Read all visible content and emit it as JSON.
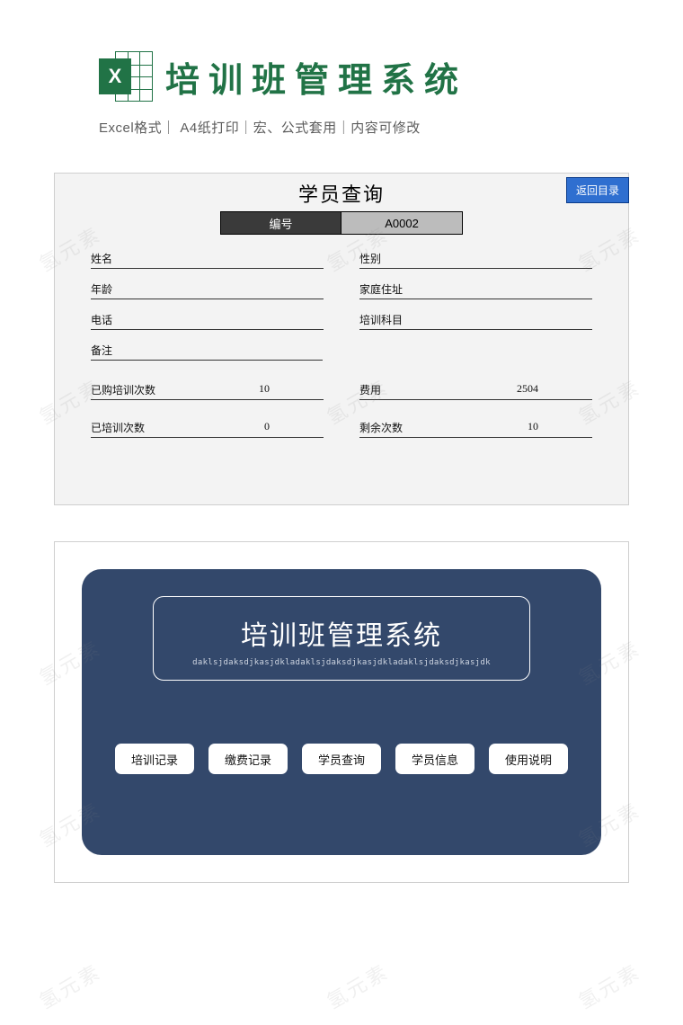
{
  "header": {
    "icon_letter": "X",
    "title": "培训班管理系统",
    "features": "Excel格式｜ A4纸打印｜宏、公式套用｜内容可修改"
  },
  "panel1": {
    "title": "学员查询",
    "return_label": "返回目录",
    "id_label": "编号",
    "id_value": "A0002",
    "fields": {
      "name_label": "姓名",
      "name_value": "",
      "gender_label": "性别",
      "gender_value": "",
      "age_label": "年龄",
      "age_value": "",
      "address_label": "家庭住址",
      "address_value": "",
      "phone_label": "电话",
      "phone_value": "",
      "subject_label": "培训科目",
      "subject_value": "",
      "remark_label": "备注",
      "remark_value": "",
      "purchased_label": "已购培训次数",
      "purchased_value": "10",
      "fee_label": "费用",
      "fee_value": "2504",
      "trained_label": "已培训次数",
      "trained_value": "0",
      "remain_label": "剩余次数",
      "remain_value": "10"
    }
  },
  "panel2": {
    "system_title": "培训班管理系统",
    "system_subtitle": "daklsjdaksdjkasjdkladaklsjdaksdjkasjdkladaklsjdaksdjkasjdk",
    "menu": [
      "培训记录",
      "缴费记录",
      "学员查询",
      "学员信息",
      "使用说明"
    ]
  },
  "watermark_text": "氢元素"
}
